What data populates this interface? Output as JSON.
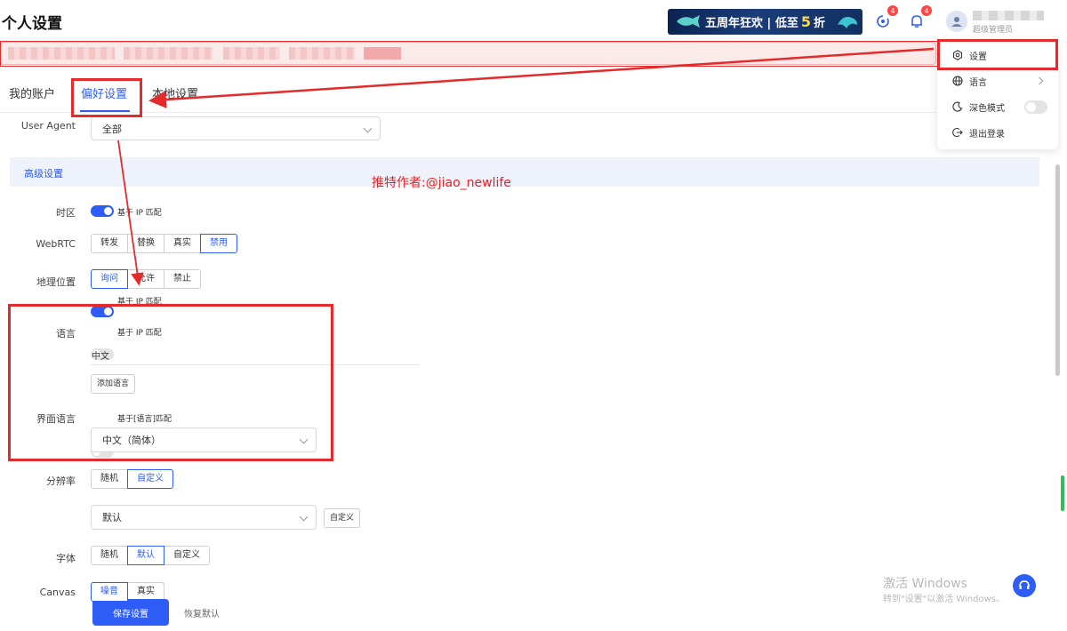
{
  "header": {
    "page_title": "个人设置",
    "promo": {
      "pre": "五周年狂欢 | 低至",
      "big": "5",
      "post": "折"
    },
    "sync_badge": "4",
    "notify_badge": "4",
    "user_role": "超级管理员"
  },
  "tabs": [
    "我的账户",
    "偏好设置",
    "本地设置"
  ],
  "watermark": "推特作者:@jiao_newlife",
  "form": {
    "ua": {
      "label": "User Agent",
      "value": "全部"
    },
    "section_title": "高级设置",
    "timezone": {
      "label": "时区",
      "toggle_text": "基于 IP 匹配"
    },
    "webrtc": {
      "label": "WebRTC",
      "options": [
        "转发",
        "替换",
        "真实",
        "禁用"
      ]
    },
    "geo": {
      "label": "地理位置",
      "options": [
        "询问",
        "允许",
        "禁止"
      ],
      "toggle_text": "基于 IP 匹配"
    },
    "language": {
      "label": "语言",
      "toggle_text": "基于 IP 匹配",
      "value": "中文",
      "add_button": "添加语言"
    },
    "ui_language": {
      "label": "界面语言",
      "toggle_text": "基于[语言]匹配",
      "value": "中文（简体）"
    },
    "resolution": {
      "label": "分辨率",
      "options": [
        "随机",
        "自定义"
      ],
      "value": "默认",
      "custom_button": "自定义"
    },
    "font": {
      "label": "字体",
      "options": [
        "随机",
        "默认",
        "自定义"
      ]
    },
    "canvas": {
      "label": "Canvas",
      "options": [
        "噪音",
        "真实"
      ]
    }
  },
  "footer": {
    "save": "保存设置",
    "reset": "恢复默认"
  },
  "menu": {
    "settings": "设置",
    "language": "语言",
    "dark_mode": "深色模式",
    "logout": "退出登录"
  },
  "os_watermark": {
    "title": "激活 Windows",
    "sub": "转到\"设置\"以激活 Windows。"
  },
  "colors": {
    "primary": "#2d5cf6",
    "annotation": "#e42a2a"
  }
}
